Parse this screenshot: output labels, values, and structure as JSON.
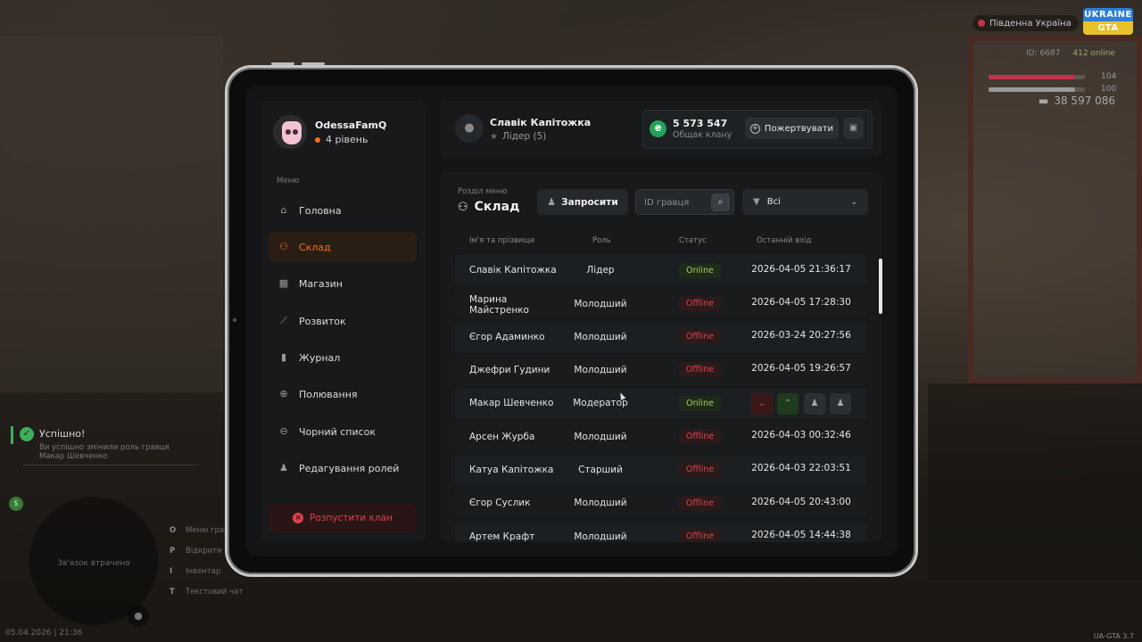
{
  "hud": {
    "server": "Південна Україна",
    "logo_line1": "UKRAINE",
    "logo_line2": "GTA",
    "id_label": "ID: 6687",
    "online": "412 online",
    "health_value": "104",
    "armor_value": "100",
    "money": "38 597 086",
    "health_fraction": 0.9,
    "armor_fraction": 0.9,
    "health_color": "#c2334a",
    "armor_color": "#9a9a9a"
  },
  "notification": {
    "title": "Успішно!",
    "message": "Ви успішно змінили роль гравця Макар Шевченко"
  },
  "minimap": {
    "caption": "Зв'язок втрачено",
    "currency_icon": "$"
  },
  "keys": [
    {
      "key": "O",
      "label": "Меню гравця"
    },
    {
      "key": "P",
      "label": "Відкрити"
    },
    {
      "key": "I",
      "label": "Інвентар"
    },
    {
      "key": "T",
      "label": "Текстовий чат"
    }
  ],
  "datetime": "05.04.2026 | 21:36",
  "version": "UA-GTA 3.7",
  "profile": {
    "name": "OdessaFamQ",
    "level": "4 рівень"
  },
  "menu": {
    "caption": "Меню",
    "items": [
      {
        "label": "Головна",
        "icon": "home-icon",
        "glyph": "⌂"
      },
      {
        "label": "Склад",
        "icon": "members-icon",
        "glyph": "⚇"
      },
      {
        "label": "Магазин",
        "icon": "shop-icon",
        "glyph": "▦"
      },
      {
        "label": "Розвиток",
        "icon": "chart-icon",
        "glyph": "⟋"
      },
      {
        "label": "Журнал",
        "icon": "journal-icon",
        "glyph": "▮"
      },
      {
        "label": "Полювання",
        "icon": "target-icon",
        "glyph": "⊕"
      },
      {
        "label": "Чорний список",
        "icon": "blacklist-icon",
        "glyph": "⊖"
      },
      {
        "label": "Редагування ролей",
        "icon": "role-edit-icon",
        "glyph": "♟"
      }
    ],
    "active_index": 1,
    "disband_label": "Розпустити клан"
  },
  "leader": {
    "name": "Славік Капітожка",
    "role": "Лідер (5)"
  },
  "bank": {
    "amount": "5 573 547",
    "label": "Общак клану",
    "currency_icon": "₴",
    "donate_label": "Пожертвувати"
  },
  "section": {
    "caption": "Розділ меню",
    "title": "Склад",
    "invite_label": "Запросити",
    "id_placeholder": "ID гравця",
    "filter_value": "Всі"
  },
  "table": {
    "headers": [
      "Ім'я та прізвище",
      "Роль",
      "Статус",
      "Останній вхід"
    ],
    "rows": [
      {
        "name": "Славік Капітожка",
        "role": "Лідер",
        "status": "Online",
        "online": true,
        "last": "2026-04-05 21:36:17"
      },
      {
        "name": "Марина Майстренко",
        "role": "Молодший",
        "status": "Offline",
        "online": false,
        "last": "2026-04-05 17:28:30"
      },
      {
        "name": "Єгор Адаминко",
        "role": "Молодший",
        "status": "Offline",
        "online": false,
        "last": "2026-03-24 20:27:56"
      },
      {
        "name": "Джефри Гудини",
        "role": "Молодший",
        "status": "Offline",
        "online": false,
        "last": "2026-04-05 19:26:57"
      },
      {
        "name": "Макар Шевченко",
        "role": "Модератор",
        "status": "Online",
        "online": true,
        "last": ""
      },
      {
        "name": "Арсен Журба",
        "role": "Молодший",
        "status": "Offline",
        "online": false,
        "last": "2026-04-03 00:32:46"
      },
      {
        "name": "Катуа Капітожка",
        "role": "Старший",
        "status": "Offline",
        "online": false,
        "last": "2026-04-03 22:03:51"
      },
      {
        "name": "Єгор Суслик",
        "role": "Молодший",
        "status": "Offline",
        "online": false,
        "last": "2026-04-05 20:43:00"
      },
      {
        "name": "Артем Крафт",
        "role": "Молодший",
        "status": "Offline",
        "online": false,
        "last": "2026-04-05 14:44:38"
      }
    ]
  }
}
